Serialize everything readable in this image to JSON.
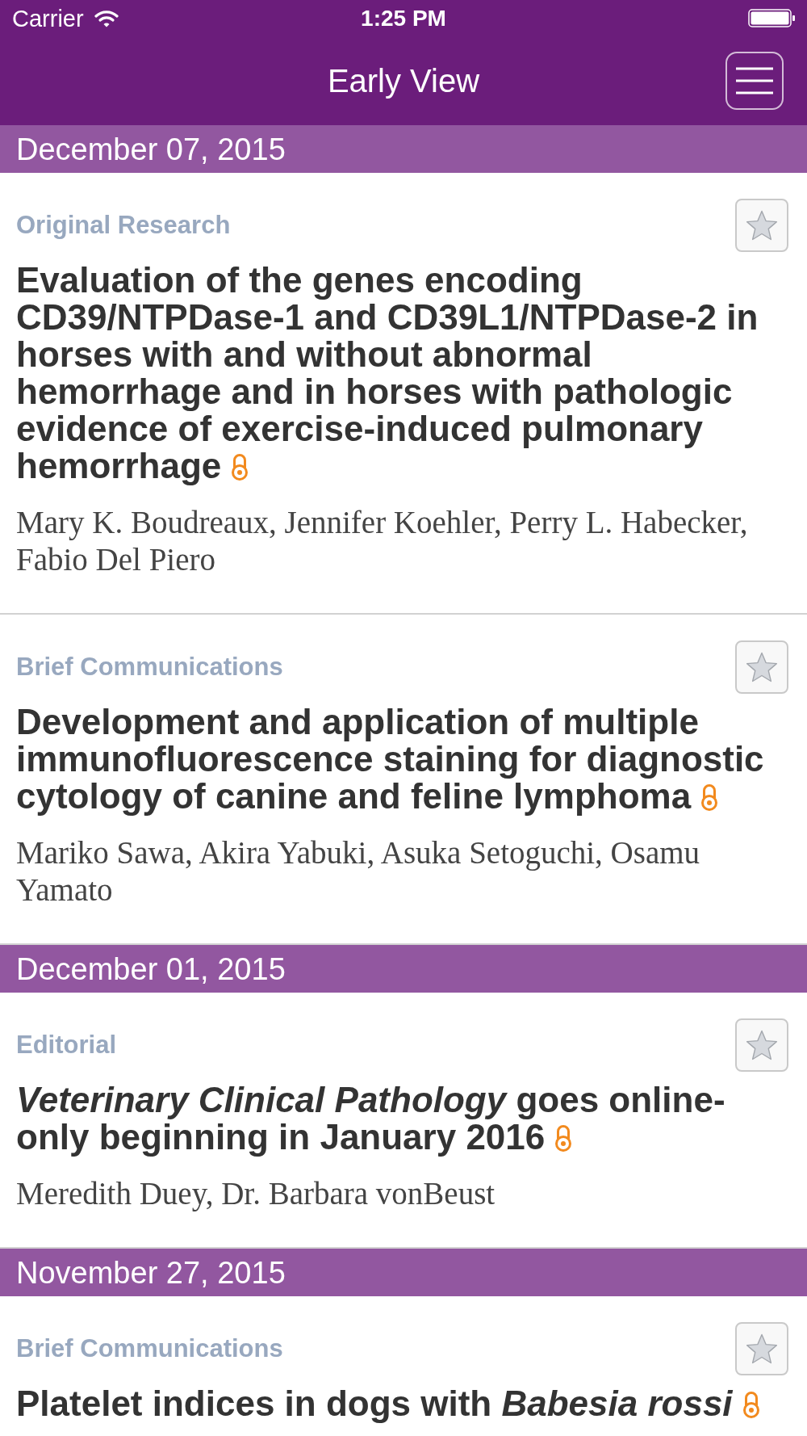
{
  "status_bar": {
    "carrier": "Carrier",
    "time": "1:25 PM"
  },
  "nav_bar": {
    "title": "Early View"
  },
  "sections": [
    {
      "date": "December 07, 2015",
      "articles": [
        {
          "category": "Original Research",
          "title": "Evaluation of the genes encoding CD39/NTPDase-1 and CD39L1/NTPDase-2 in horses with and without abnormal hemorrhage and in horses with pathologic evidence of exercise-induced pulmonary hemorrhage",
          "open_access": true,
          "starred": false,
          "authors": "Mary K. Boudreaux, Jennifer Koehler, Perry L. Habecker, Fabio Del Piero"
        },
        {
          "category": "Brief Communications",
          "title": "Development and application of multiple immunofluorescence staining for diagnostic cytology of canine and feline lymphoma",
          "open_access": true,
          "starred": false,
          "authors": "Mariko Sawa, Akira Yabuki, Asuka Setoguchi, Osamu Yamato"
        }
      ]
    },
    {
      "date": "December 01, 2015",
      "articles": [
        {
          "category": "Editorial",
          "title": "*Veterinary Clinical Pathology* goes online-only beginning in January 2016",
          "open_access": true,
          "starred": false,
          "authors": "Meredith Duey, Dr. Barbara vonBeust"
        }
      ]
    },
    {
      "date": "November 27, 2015",
      "articles": [
        {
          "category": "Brief Communications",
          "title": "Platelet indices in dogs with *Babesia rossi*",
          "open_access": true,
          "starred": false
        }
      ]
    }
  ]
}
